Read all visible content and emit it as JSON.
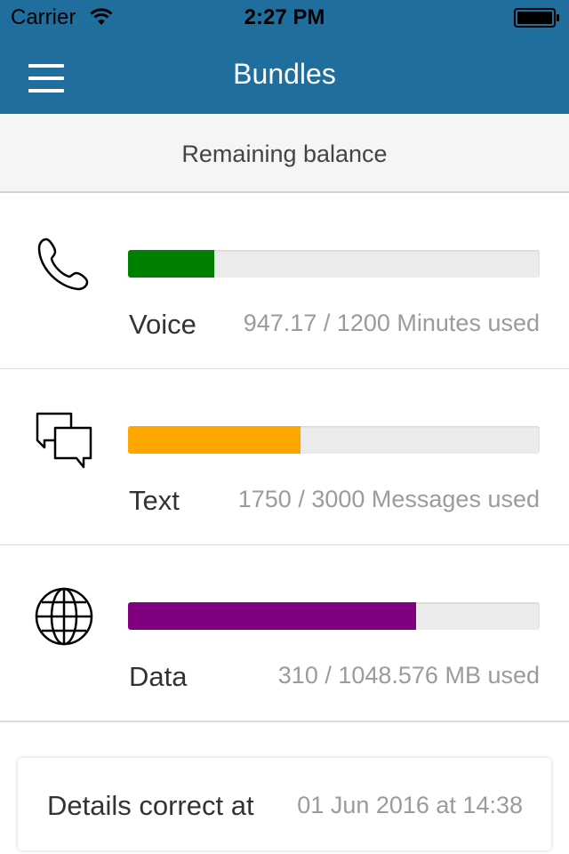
{
  "status_bar": {
    "carrier": "Carrier",
    "time": "2:27 PM"
  },
  "nav": {
    "title": "Bundles",
    "menu_icon": "hamburger-menu-icon"
  },
  "subheader": {
    "title": "Remaining balance"
  },
  "bundles": [
    {
      "label": "Voice",
      "usage": "947.17 / 1200 Minutes used",
      "used": 947.17,
      "total": 1200,
      "fill_fraction": 0.21,
      "color": "#008000",
      "icon": "phone-icon"
    },
    {
      "label": "Text",
      "usage": "1750 / 3000 Messages used",
      "used": 1750,
      "total": 3000,
      "fill_fraction": 0.42,
      "color": "#ffa500",
      "icon": "chat-bubbles-icon"
    },
    {
      "label": "Data",
      "usage": "310 / 1048.576 MB used",
      "used": 310,
      "total": 1048.576,
      "fill_fraction": 0.7,
      "color": "#800080",
      "icon": "globe-icon"
    }
  ],
  "details": {
    "label": "Details correct at",
    "value": "01 Jun 2016 at 14:38"
  },
  "colors": {
    "header": "#1f6e9e",
    "subheader_bg": "#f5f5f5"
  }
}
